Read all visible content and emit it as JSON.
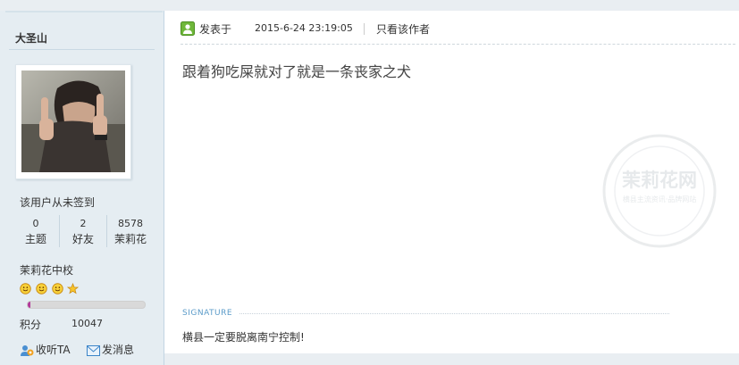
{
  "user": {
    "name": "大圣山",
    "checkin_status": "该用户从未签到",
    "stats": [
      {
        "value": "0",
        "label": "主题"
      },
      {
        "value": "2",
        "label": "好友"
      },
      {
        "value": "8578",
        "label": "茉莉花"
      }
    ],
    "rank": "茉莉花中校",
    "level_icons": [
      "smile-icon",
      "smile-icon",
      "smile-icon",
      "star-icon"
    ],
    "progress_percent": 2,
    "credits_label": "积分",
    "credits_value": "10047",
    "actions": {
      "follow": "收听TA",
      "message": "发消息"
    }
  },
  "post": {
    "posted_label": "发表于",
    "posted_time": "2015-6-24 23:19:05",
    "only_author": "只看该作者",
    "content": "跟着狗吃屎就对了就是一条丧家之犬",
    "signature_label": "SIGNATURE",
    "signature_text": "横县一定要脱离南宁控制!"
  },
  "watermark": {
    "title": "茉莉花网",
    "subtitle": "横县主流资讯·品牌网站"
  },
  "colors": {
    "sidebar_bg": "#e5edf2",
    "progress_fill": "#b23a9b",
    "signature_label": "#5b9bc9"
  }
}
